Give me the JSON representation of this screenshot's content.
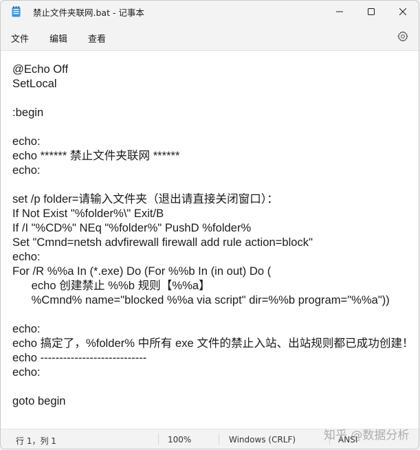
{
  "window": {
    "title": "禁止文件夹联网.bat - 记事本",
    "minimize_icon": "minimize-icon",
    "maximize_icon": "maximize-icon",
    "close_icon": "close-icon"
  },
  "menu": {
    "items": [
      "文件",
      "编辑",
      "查看"
    ],
    "settings_icon": "gear-icon"
  },
  "editor": {
    "lines": [
      "@Echo Off",
      "SetLocal",
      "",
      ":begin",
      "",
      "echo:",
      "echo ****** 禁止文件夹联网 ******",
      "echo:",
      "",
      "set /p folder=请输入文件夹（退出请直接关闭窗口）：",
      "If Not Exist \"%folder%\\\" Exit/B",
      "If /I \"%CD%\" NEq \"%folder%\" PushD %folder%",
      "Set \"Cmnd=netsh advfirewall firewall add rule action=block\"",
      "echo:",
      "For /R %%a In (*.exe) Do (For %%b In (in out) Do (",
      "      echo 创建禁止 %%b 规则【%%a】",
      "      %Cmnd% name=\"blocked %%a via script\" dir=%%b program=\"%%a\"))",
      "",
      "echo:",
      "echo 搞定了，%folder% 中所有 exe 文件的禁止入站、出站规则都已成功创建！",
      "echo ----------------------------",
      "echo:",
      "",
      "goto begin"
    ]
  },
  "status": {
    "position": "行 1，列 1",
    "zoom": "100%",
    "line_ending": "Windows (CRLF)",
    "encoding": "ANSI"
  },
  "watermark": "知乎 @数据分析"
}
